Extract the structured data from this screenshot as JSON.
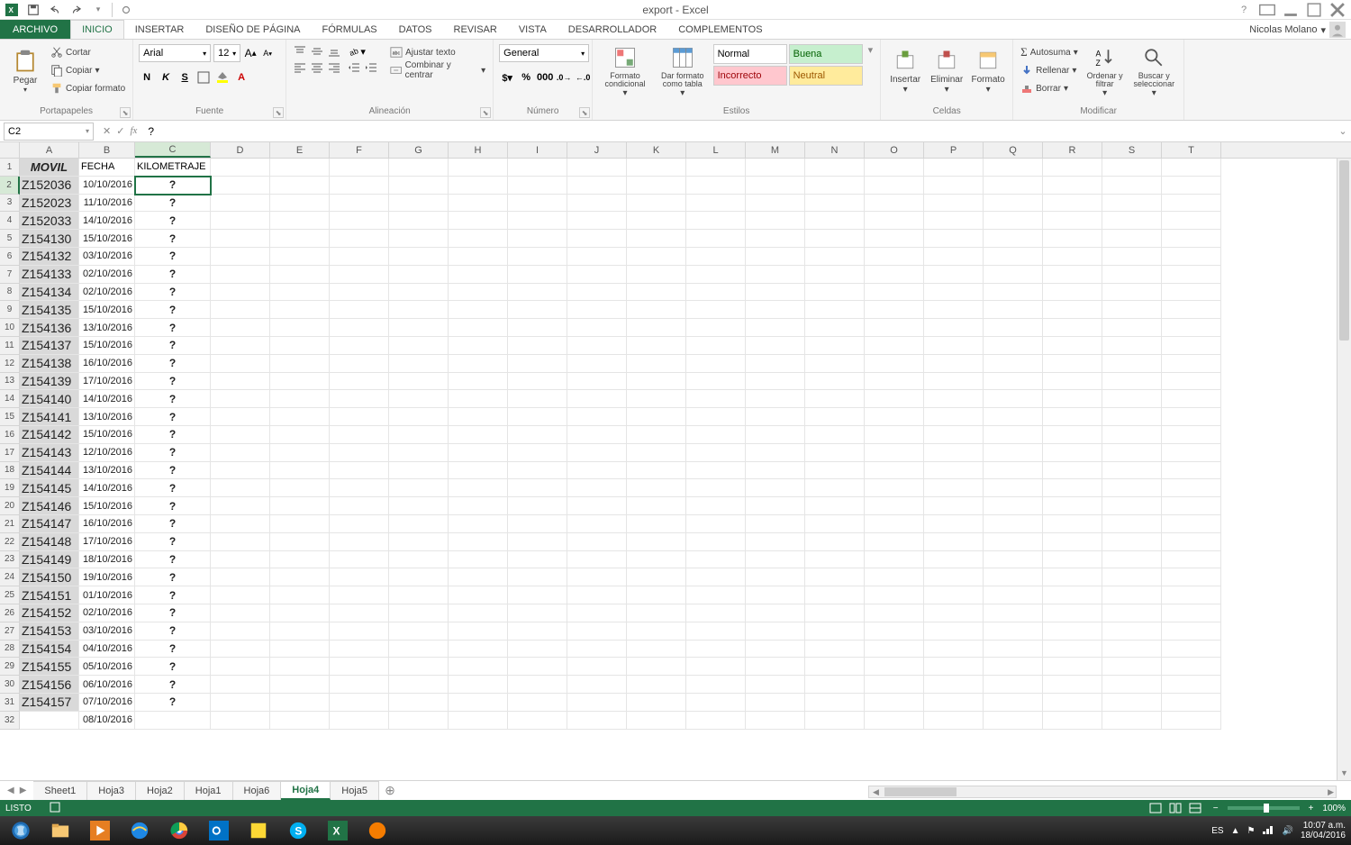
{
  "window": {
    "title": "export - Excel"
  },
  "user": {
    "name": "Nicolas Molano"
  },
  "tabs": {
    "file": "ARCHIVO",
    "list": [
      "INICIO",
      "INSERTAR",
      "DISEÑO DE PÁGINA",
      "FÓRMULAS",
      "DATOS",
      "REVISAR",
      "VISTA",
      "DESARROLLADOR",
      "COMPLEMENTOS"
    ],
    "active": "INICIO"
  },
  "ribbon": {
    "portapapeles": {
      "label": "Portapapeles",
      "pegar": "Pegar",
      "cortar": "Cortar",
      "copiar": "Copiar",
      "copiar_formato": "Copiar formato"
    },
    "fuente": {
      "label": "Fuente",
      "name": "Arial",
      "size": "12"
    },
    "alineacion": {
      "label": "Alineación",
      "ajustar": "Ajustar texto",
      "combinar": "Combinar y centrar"
    },
    "numero": {
      "label": "Número",
      "formato": "General"
    },
    "estilos": {
      "label": "Estilos",
      "formato_cond": "Formato condicional",
      "dar_formato": "Dar formato como tabla",
      "normal": "Normal",
      "buena": "Buena",
      "incorrecto": "Incorrecto",
      "neutral": "Neutral"
    },
    "celdas": {
      "label": "Celdas",
      "insertar": "Insertar",
      "eliminar": "Eliminar",
      "formato": "Formato"
    },
    "modificar": {
      "label": "Modificar",
      "autosuma": "Autosuma",
      "rellenar": "Rellenar",
      "borrar": "Borrar",
      "ordenar": "Ordenar y filtrar",
      "buscar": "Buscar y seleccionar"
    }
  },
  "namebox": "C2",
  "formula": "?",
  "columns": [
    "A",
    "B",
    "C",
    "D",
    "E",
    "F",
    "G",
    "H",
    "I",
    "J",
    "K",
    "L",
    "M",
    "N",
    "O",
    "P",
    "Q",
    "R",
    "S",
    "T"
  ],
  "headers": {
    "A": "MOVIL",
    "B": "FECHA",
    "C": "KILOMETRAJE"
  },
  "rows": [
    {
      "n": 2,
      "a": "Z152036",
      "b": "10/10/2016",
      "c": "?"
    },
    {
      "n": 3,
      "a": "Z152023",
      "b": "11/10/2016",
      "c": "?"
    },
    {
      "n": 4,
      "a": "Z152033",
      "b": "14/10/2016",
      "c": "?"
    },
    {
      "n": 5,
      "a": "Z154130",
      "b": "15/10/2016",
      "c": "?"
    },
    {
      "n": 6,
      "a": "Z154132",
      "b": "03/10/2016",
      "c": "?"
    },
    {
      "n": 7,
      "a": "Z154133",
      "b": "02/10/2016",
      "c": "?"
    },
    {
      "n": 8,
      "a": "Z154134",
      "b": "02/10/2016",
      "c": "?"
    },
    {
      "n": 9,
      "a": "Z154135",
      "b": "15/10/2016",
      "c": "?"
    },
    {
      "n": 10,
      "a": "Z154136",
      "b": "13/10/2016",
      "c": "?"
    },
    {
      "n": 11,
      "a": "Z154137",
      "b": "15/10/2016",
      "c": "?"
    },
    {
      "n": 12,
      "a": "Z154138",
      "b": "16/10/2016",
      "c": "?"
    },
    {
      "n": 13,
      "a": "Z154139",
      "b": "17/10/2016",
      "c": "?"
    },
    {
      "n": 14,
      "a": "Z154140",
      "b": "14/10/2016",
      "c": "?"
    },
    {
      "n": 15,
      "a": "Z154141",
      "b": "13/10/2016",
      "c": "?"
    },
    {
      "n": 16,
      "a": "Z154142",
      "b": "15/10/2016",
      "c": "?"
    },
    {
      "n": 17,
      "a": "Z154143",
      "b": "12/10/2016",
      "c": "?"
    },
    {
      "n": 18,
      "a": "Z154144",
      "b": "13/10/2016",
      "c": "?"
    },
    {
      "n": 19,
      "a": "Z154145",
      "b": "14/10/2016",
      "c": "?"
    },
    {
      "n": 20,
      "a": "Z154146",
      "b": "15/10/2016",
      "c": "?"
    },
    {
      "n": 21,
      "a": "Z154147",
      "b": "16/10/2016",
      "c": "?"
    },
    {
      "n": 22,
      "a": "Z154148",
      "b": "17/10/2016",
      "c": "?"
    },
    {
      "n": 23,
      "a": "Z154149",
      "b": "18/10/2016",
      "c": "?"
    },
    {
      "n": 24,
      "a": "Z154150",
      "b": "19/10/2016",
      "c": "?"
    },
    {
      "n": 25,
      "a": "Z154151",
      "b": "01/10/2016",
      "c": "?"
    },
    {
      "n": 26,
      "a": "Z154152",
      "b": "02/10/2016",
      "c": "?"
    },
    {
      "n": 27,
      "a": "Z154153",
      "b": "03/10/2016",
      "c": "?"
    },
    {
      "n": 28,
      "a": "Z154154",
      "b": "04/10/2016",
      "c": "?"
    },
    {
      "n": 29,
      "a": "Z154155",
      "b": "05/10/2016",
      "c": "?"
    },
    {
      "n": 30,
      "a": "Z154156",
      "b": "06/10/2016",
      "c": "?"
    },
    {
      "n": 31,
      "a": "Z154157",
      "b": "07/10/2016",
      "c": "?"
    },
    {
      "n": 32,
      "a": "",
      "b": "08/10/2016",
      "c": ""
    }
  ],
  "selected_cell": "C2",
  "sheets": [
    "Sheet1",
    "Hoja3",
    "Hoja2",
    "Hoja1",
    "Hoja6",
    "Hoja4",
    "Hoja5"
  ],
  "active_sheet": "Hoja4",
  "status": {
    "text": "LISTO",
    "zoom": "100%"
  },
  "taskbar": {
    "lang": "ES",
    "time": "10:07 a.m.",
    "date": "18/04/2016"
  }
}
